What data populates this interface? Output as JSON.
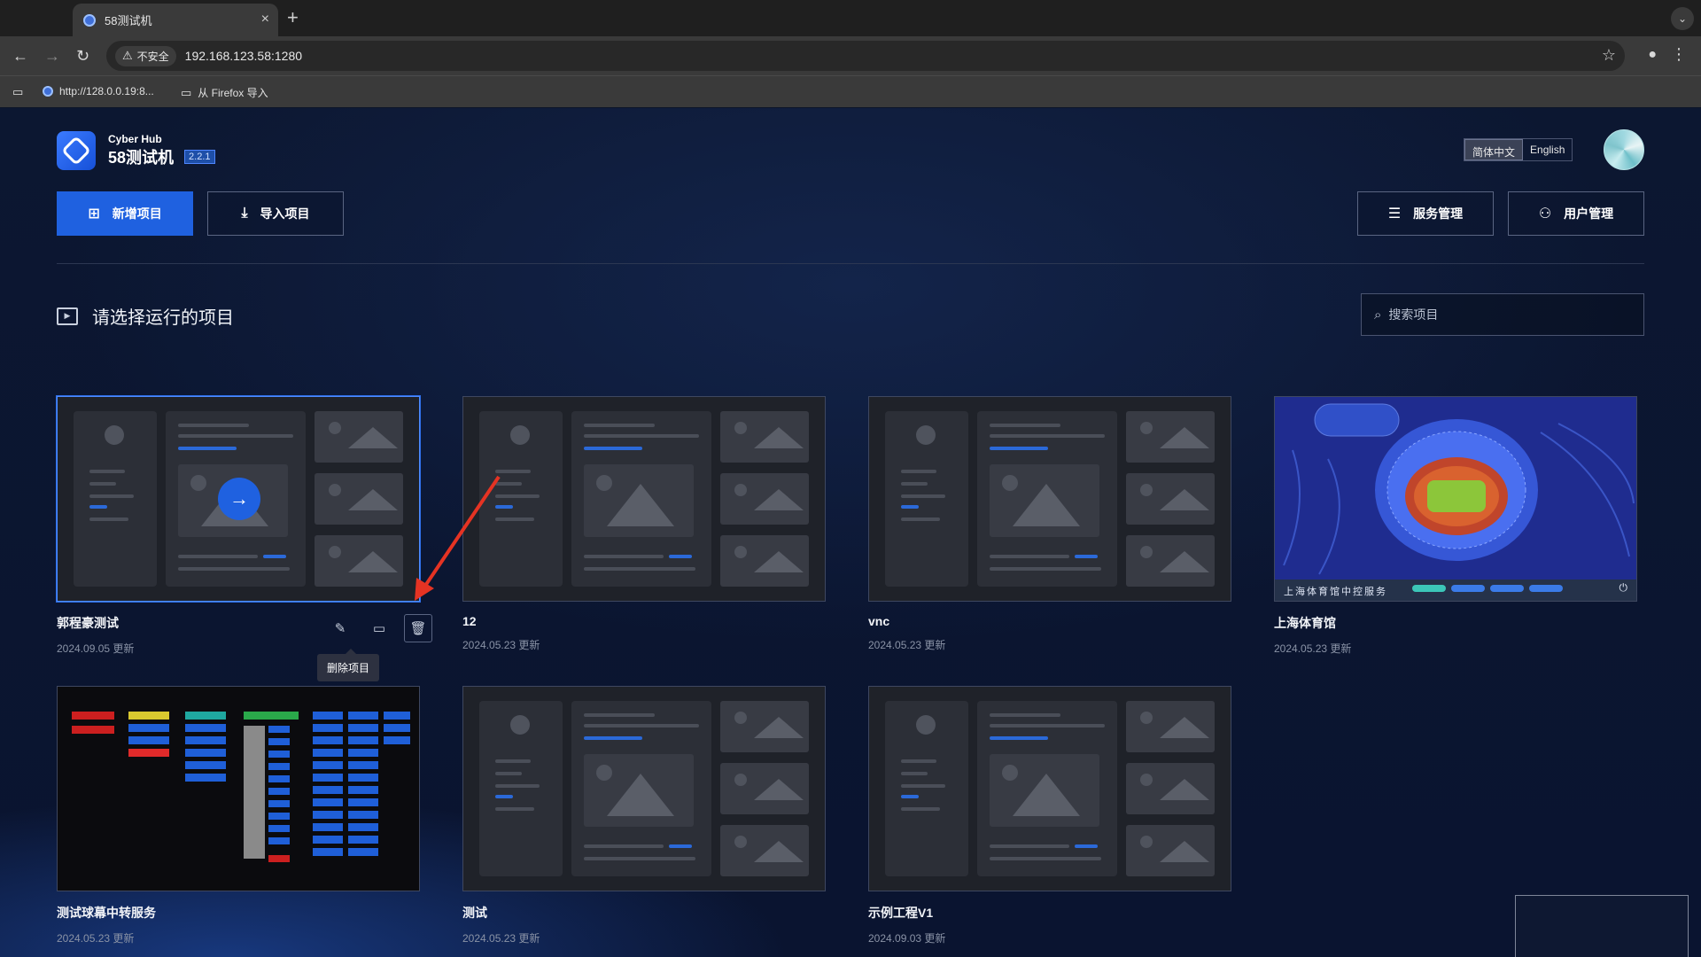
{
  "browser": {
    "tab_title": "58测试机",
    "tab_close": "×",
    "new_tab": "+",
    "insecure_label": "不安全",
    "url": "192.168.123.58:1280",
    "bookmarks": [
      "http://128.0.0.19:8...",
      "从 Firefox 导入"
    ]
  },
  "app": {
    "brand_small": "Cyber Hub",
    "brand_name": "58测试机",
    "version": "2.2.1",
    "lang_options": [
      "简体中文",
      "English"
    ],
    "lang_active": "简体中文",
    "buttons": {
      "new_project": "新增项目",
      "import_project": "导入项目",
      "service_mgmt": "服务管理",
      "user_mgmt": "用户管理"
    },
    "section_title": "请选择运行的项目",
    "search_placeholder": "搜索项目",
    "tooltip": "删除项目",
    "projects": [
      {
        "name": "郭程豪测试",
        "date": "2024.09.05 更新"
      },
      {
        "name": "12",
        "date": "2024.05.23 更新"
      },
      {
        "name": "vnc",
        "date": "2024.05.23 更新"
      },
      {
        "name": "上海体育馆",
        "date": "2024.05.23 更新"
      },
      {
        "name": "测试球幕中转服务",
        "date": "2024.05.23 更新"
      },
      {
        "name": "测试",
        "date": "2024.05.23 更新"
      },
      {
        "name": "示例工程V1",
        "date": "2024.09.03 更新"
      }
    ],
    "stadium_caption": "上海体育馆中控服务",
    "icons": [
      "new-folder-icon",
      "import-icon",
      "server-icon",
      "users-icon",
      "folder-play-icon",
      "search-icon",
      "edit-icon",
      "folder-icon",
      "trash-icon",
      "arrow-right-icon"
    ]
  },
  "colors": {
    "accent": "#1f61e0",
    "annotation_arrow": "#e53323"
  }
}
